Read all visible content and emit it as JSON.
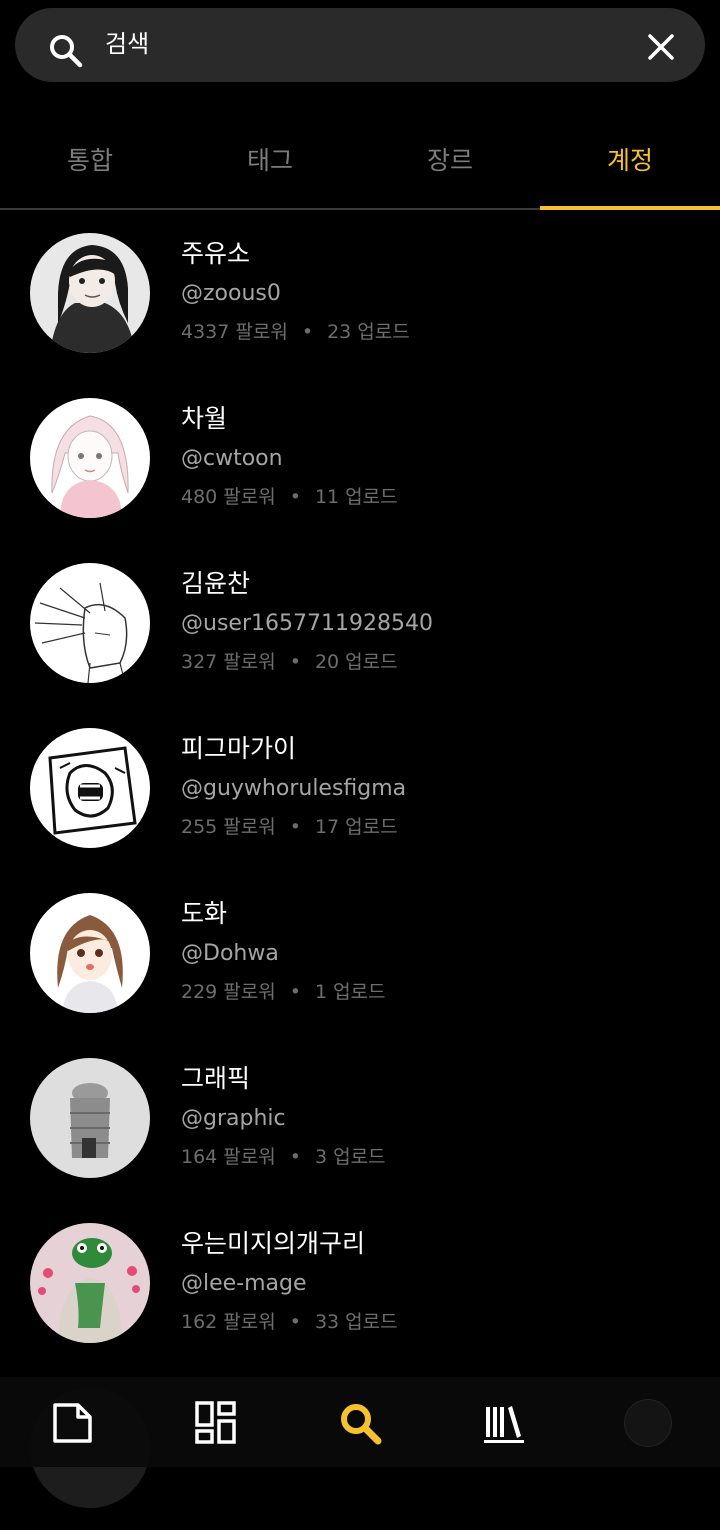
{
  "search": {
    "query": "검색",
    "close_icon": "close-icon",
    "search_icon": "search-icon"
  },
  "tabs": [
    {
      "label": "통합",
      "active": false
    },
    {
      "label": "태그",
      "active": false
    },
    {
      "label": "장르",
      "active": false
    },
    {
      "label": "계정",
      "active": true
    }
  ],
  "accounts": [
    {
      "name": "주유소",
      "handle": "@zoous0",
      "followers": "4337 팔로워",
      "uploads": "23 업로드"
    },
    {
      "name": "차월",
      "handle": "@cwtoon",
      "followers": "480 팔로워",
      "uploads": "11 업로드"
    },
    {
      "name": "김윤찬",
      "handle": "@user1657711928540",
      "followers": "327 팔로워",
      "uploads": "20 업로드"
    },
    {
      "name": "피그마가이",
      "handle": "@guywhorulesfigma",
      "followers": "255 팔로워",
      "uploads": "17 업로드"
    },
    {
      "name": "도화",
      "handle": "@Dohwa",
      "followers": "229 팔로워",
      "uploads": "1 업로드"
    },
    {
      "name": "그래픽",
      "handle": "@graphic",
      "followers": "164 팔로워",
      "uploads": "3 업로드"
    },
    {
      "name": "우는미지의개구리",
      "handle": "@lee-mage",
      "followers": "162 팔로워",
      "uploads": "33 업로드"
    }
  ],
  "stat_separator": "•",
  "bottom_nav": [
    {
      "icon": "document-icon",
      "active": false
    },
    {
      "icon": "grid-icon",
      "active": false
    },
    {
      "icon": "search-icon",
      "active": true
    },
    {
      "icon": "library-icon",
      "active": false
    },
    {
      "icon": "profile-icon",
      "active": false
    }
  ],
  "colors": {
    "accent": "#f5c12e",
    "background": "#000000",
    "search_bg": "#2a2a2a"
  }
}
